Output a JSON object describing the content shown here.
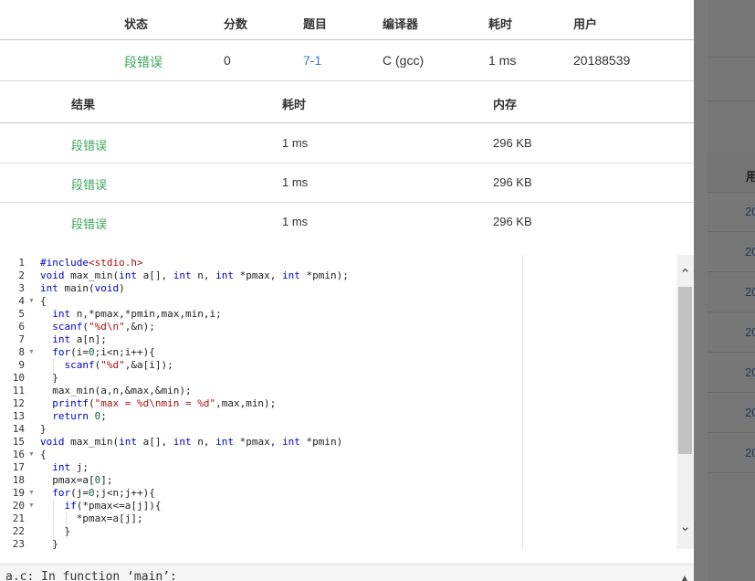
{
  "background": {
    "column_header": "用户",
    "user_ids": [
      "20",
      "20",
      "20",
      "20",
      "20",
      "20",
      "20"
    ]
  },
  "summary": {
    "headers": [
      "状态",
      "分数",
      "题目",
      "编译器",
      "耗时",
      "用户"
    ],
    "row": {
      "status": "段错误",
      "score": "0",
      "problem": "7-1",
      "compiler": "C (gcc)",
      "time": "1 ms",
      "user": "20188539"
    }
  },
  "testcases": {
    "headers": [
      "结果",
      "耗时",
      "内存"
    ],
    "rows": [
      {
        "result": "段错误",
        "time": "1 ms",
        "memory": "296 KB"
      },
      {
        "result": "段错误",
        "time": "1 ms",
        "memory": "296 KB"
      },
      {
        "result": "段错误",
        "time": "1 ms",
        "memory": "296 KB"
      }
    ]
  },
  "code": {
    "line_numbers": [
      "1",
      "2",
      "3",
      "4",
      "5",
      "6",
      "7",
      "8",
      "9",
      "10",
      "11",
      "12",
      "13",
      "14",
      "15",
      "16",
      "17",
      "18",
      "19",
      "20",
      "21",
      "22",
      "23"
    ],
    "lines": [
      "#include<stdio.h>",
      "void max_min(int a[], int n, int *pmax, int *pmin);",
      "int main(void)",
      "{",
      "  int n,*pmax,*pmin,max,min,i;",
      "  scanf(\"%d\\n\",&n);",
      "  int a[n];",
      "  for(i=0;i<n;i++){",
      "    scanf(\"%d\",&a[i]);",
      "  }",
      "  max_min(a,n,&max,&min);",
      "  printf(\"max = %d\\nmin = %d\",max,min);",
      "  return 0;",
      "}",
      "void max_min(int a[], int n, int *pmax, int *pmin)",
      "{",
      "  int j;",
      "  pmax=a[0];",
      "  for(j=0;j<n;j++){",
      "    if(*pmax<=a[j]){",
      "      *pmax=a[j];",
      "    }",
      "  }"
    ]
  },
  "output": {
    "text": "a.c: In function ‘main’:"
  },
  "colors": {
    "status_error": "#3ba55c",
    "link": "#2f7bc4",
    "keyword": "#0000cc",
    "string": "#aa1111"
  }
}
